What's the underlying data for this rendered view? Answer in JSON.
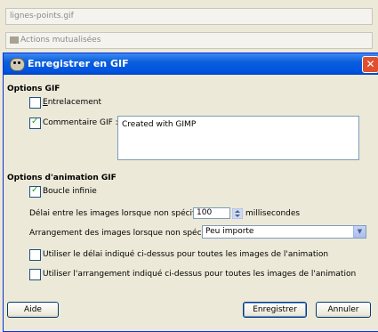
{
  "background": {
    "file_label": "lignes-points.gif",
    "actions_label": "Actions mutualisées"
  },
  "dialog": {
    "title": "Enregistrer en GIF",
    "gif_options": {
      "heading": "Options GIF",
      "interlace_label": "Entrelacement",
      "interlace_checked": false,
      "comment_label": "Commentaire GIF :",
      "comment_checked": true,
      "comment_text": "Created with GIMP"
    },
    "animation_options": {
      "heading": "Options d'animation GIF",
      "loop_label": "Boucle infinie",
      "loop_checked": true,
      "delay_label": "Délai entre les images lorsque non spécifié :",
      "delay_value": "100",
      "delay_unit": "millisecondes",
      "disposal_label": "Arrangement des images lorsque non spécifié :",
      "disposal_value": "Peu importe",
      "use_delay_label": "Utiliser le délai indiqué ci-dessus pour toutes les images de l'animation",
      "use_delay_checked": false,
      "use_disposal_label": "Utiliser l'arrangement indiqué ci-dessus pour toutes les images de l'animation",
      "use_disposal_checked": false
    },
    "buttons": {
      "help": "Aide",
      "save": "Enregistrer",
      "cancel": "Annuler"
    }
  },
  "colors": {
    "titlebar": "#0054e3",
    "window_bg": "#ece9d8",
    "check_mark": "#21a121"
  }
}
